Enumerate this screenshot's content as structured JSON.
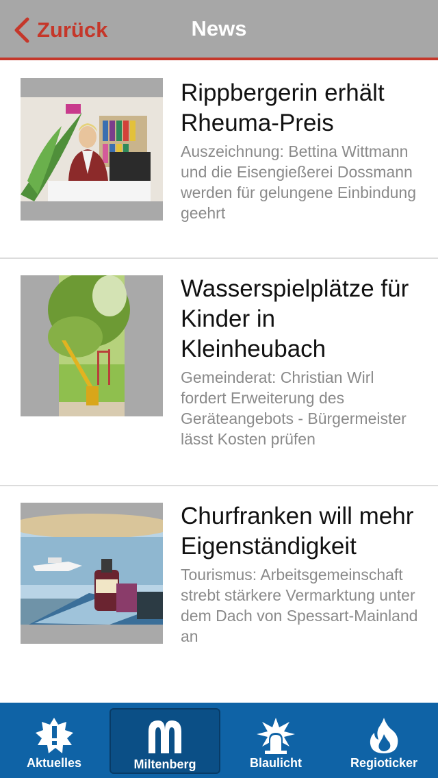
{
  "header": {
    "back_label": "Zurück",
    "title": "News"
  },
  "articles": [
    {
      "title": "Rippbergerin erhält Rheuma-Preis",
      "teaser": "Auszeichnung: Bettina Wittmann und die Eisengießerei Dossmann werden für gelungene Einbindung geehrt"
    },
    {
      "title": "Wasserspielplätze für Kinder in Kleinheubach",
      "teaser": "Gemeinderat: Christian Wirl fordert Erweiterung des Geräteangebots - Bürgermeister lässt Kosten prüfen"
    },
    {
      "title": "Churfranken will mehr Eigenständigkeit",
      "teaser": "Tourismus: Arbeitsgemeinschaft strebt stärkere Vermarktung unter dem Dach von Spessart-Mainland an"
    }
  ],
  "tabs": [
    {
      "label": "Aktuelles",
      "icon": "exclamation-badge-icon",
      "active": false
    },
    {
      "label": "Miltenberg",
      "icon": "miltenberg-m-icon",
      "active": true
    },
    {
      "label": "Blaulicht",
      "icon": "siren-icon",
      "active": false
    },
    {
      "label": "Regioticker",
      "icon": "flame-icon",
      "active": false
    }
  ],
  "colors": {
    "header_bg": "#a7a7a7",
    "accent_red": "#c5372a",
    "tabbar_bg": "#0f63a6",
    "tab_active_bg": "#0b4f86"
  }
}
